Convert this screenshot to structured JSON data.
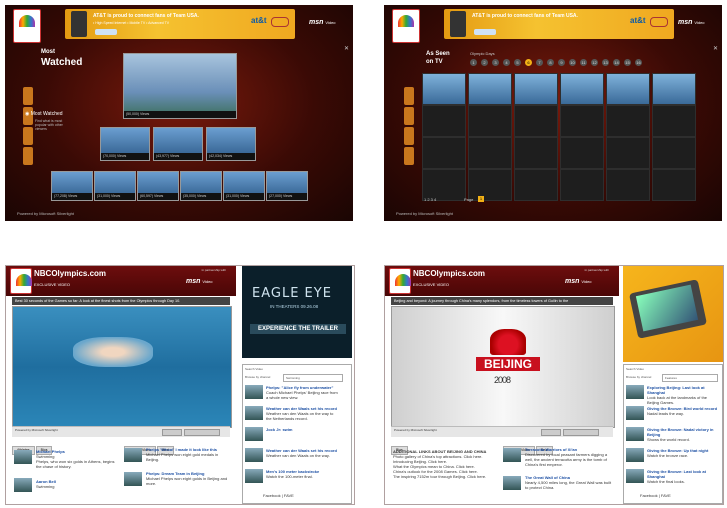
{
  "panel1": {
    "banner_text": "AT&T is proud to connect fans of Team USA.",
    "banner_sub": "• High Speed Internet   • Mobile TV   • Advanced TV",
    "att": "at&t",
    "msn": "msn",
    "msn_video": "Video",
    "section_line1": "Most",
    "section_line2": "Watched",
    "side_label": "Most Watched",
    "side_desc": "Find what is most popular with other viewers",
    "main_caption": "(50,000) Views",
    "row1": [
      "(70,000) Views",
      "(43,977) Views",
      "(42,034) Views"
    ],
    "row2": [
      "(77,208) Views",
      "(31,000) Views",
      "(60,597) Views",
      "(35,000) Views",
      "(31,000) Views",
      "(27,000) Views"
    ],
    "powered": "Powered by Microsoft Silverlight"
  },
  "panel2": {
    "banner_text": "AT&T is proud to connect fans of Team USA.",
    "att": "at&t",
    "msn": "msn",
    "msn_video": "Video",
    "section_line1": "As Seen",
    "section_line2": "on TV",
    "olympic_days": "Olympic Days",
    "pager": "1 2 3 4",
    "page_label": "Page",
    "page_num": "1",
    "powered": "Powered by Microsoft Silverlight",
    "days": [
      "1",
      "2",
      "3",
      "4",
      "5",
      "6",
      "7",
      "8",
      "9",
      "10",
      "11",
      "12",
      "13",
      "14",
      "15",
      "16"
    ]
  },
  "panel3": {
    "site_title": "NBCOlympics.com",
    "exclusive": "EXCLUSIVE VIDEO",
    "partner": "in partnership with",
    "msn": "msn",
    "msn_video": "Video",
    "caption": "Best 30 seconds of the Games so far: A look at the finest shots from the Olympics through Day 10.",
    "powered": "Powered by Microsoft Silverlight",
    "tabs_left": [
      "Athletes",
      "Bios"
    ],
    "tabs_mid": [
      "Related Video",
      "Beat"
    ],
    "athlete1": "Michael Phelps",
    "athlete1_sport": "Swimming",
    "athlete1_desc": "Phelps, who won six golds in Athens, begins the chase of history.",
    "athlete2": "Aaron Bell",
    "athlete2_sport": "Swimming",
    "rel1_title": "Phelps 'Whoa!' I made it look like this",
    "rel1_desc": "Michael Phelps won eight gold medals in Beijing.",
    "rel2_title": "Phelps: Dream Team in Beijing",
    "rel2_desc": "Michael Phelps won eight golds in Beijing and more.",
    "ad_title": "EAGLE EYE",
    "ad_sub": "IN THEATERS 09.26.08",
    "ad_cta": "EXPERIENCE THE TRAILER",
    "browse_label": "Browse by channel",
    "browse_value": "Swimming",
    "search": "Search Video",
    "side_items": [
      "Phelps: \"Alice fly from underwater\"",
      "Weather can der Waals set his record",
      "Jock Jr: swim",
      "Weather can der Waals set his record",
      "Men's 100 meter backstroke"
    ],
    "side_descs": [
      "Coach Michael Phelps' Beijing race from a whole new view.",
      "Weather van den Waals on the way to the Netherlands record.",
      "",
      "Weather van den Waals on the way.",
      "Watch the 100-meter final."
    ],
    "facebook": "Facebook",
    "fave": "FAVE"
  },
  "panel4": {
    "site_title": "NBCOlympics.com",
    "exclusive": "EXCLUSIVE VIDEO",
    "partner": "in partnership with",
    "msn": "msn",
    "msn_video": "Video",
    "caption": "Beijing and beyond: A journey through China's many splendors, from the timeless towers of Guilin to the",
    "powered": "Powered by Microsoft Silverlight",
    "bj_word": "BEIJING",
    "bj_year": "2008",
    "tabs_left": [
      "Bios"
    ],
    "tabs_mid": [
      "Related Video",
      "Beat"
    ],
    "links_title": "ADDITIONAL LINKS ABOUT BEIJING AND CHINA",
    "links": [
      "Photo gallery of China's top attractions. Click here.",
      "Introducing Beijing. Click here.",
      "What the Olympics mean to China. Click here.",
      "China's outlook for the 2008 Games. Click here.",
      "The inspiring 7152m tour through Beijing. Click here."
    ],
    "rel1_title": "Terracotta Warriors of Xi'an",
    "rel1_desc": "Discovered by local peasant farmers digging a well, the ancient terracotta army is the tomb of China's first emperor.",
    "rel2_title": "The Great Wall of China",
    "rel2_desc": "Nearly 4,500 miles long, the Great Wall was built to protect China.",
    "browse_label": "Browse by channel",
    "browse_value": "Features",
    "search": "Search Video",
    "side_items": [
      "Exploring Beijing: Last look at Shanghai",
      "Giving the Bronze: Bird world record",
      "Giving the Bronze: Nadal victory in Beijing",
      "Giving the Bronze: Up that night",
      "Giving the Bronze: Last look at Shanghai"
    ],
    "side_descs": [
      "Look back at the landmarks of the Beijing Games.",
      "Nadal leads the way.",
      "Shows the world record.",
      "Watch the bronze race.",
      "Watch the final looks."
    ],
    "facebook": "Facebook",
    "fave": "FAVE"
  }
}
